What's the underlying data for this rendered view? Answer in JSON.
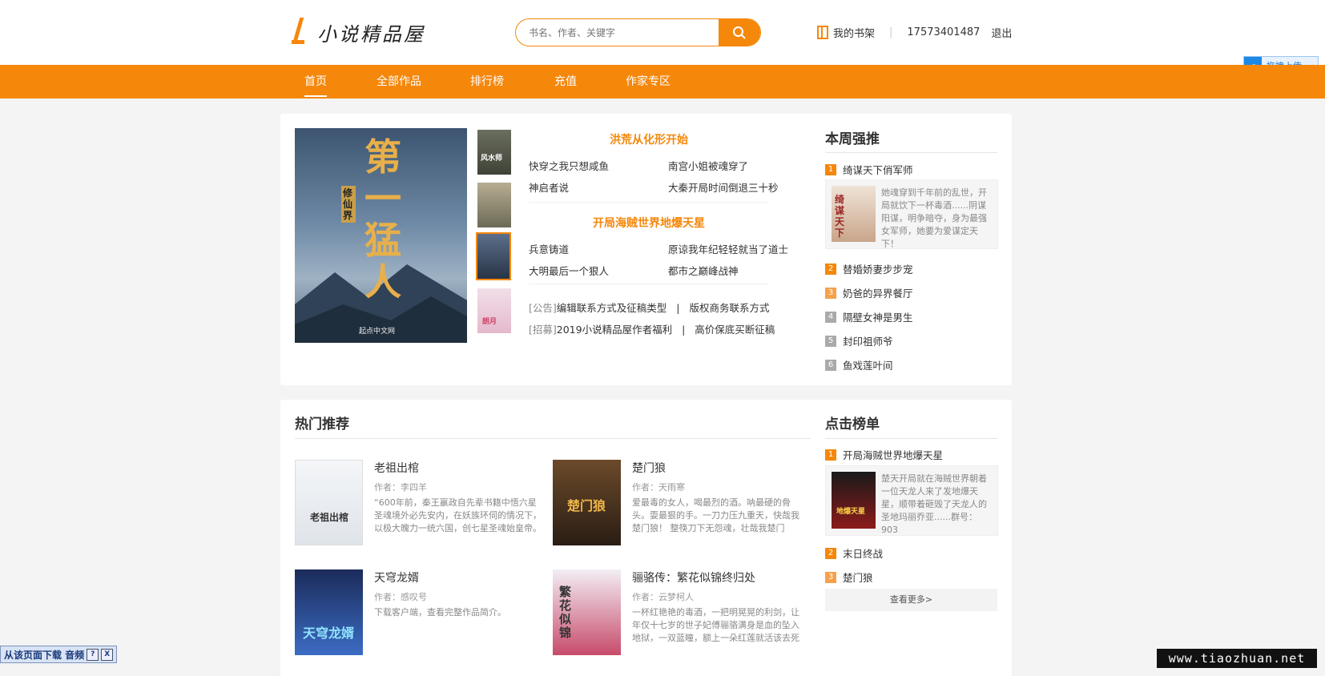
{
  "header": {
    "logo_text": "小说精品屋",
    "search_placeholder": "书名、作者、关键字",
    "shelf_label": "我的书架",
    "separator": "|",
    "phone": "17573401487",
    "logout_label": "退出"
  },
  "nav": {
    "items": [
      "首页",
      "全部作品",
      "排行榜",
      "充值",
      "作家专区"
    ]
  },
  "upload_button": "拖拽上传",
  "featured": {
    "cover_title": "第一猛人",
    "cover_subtitle": "修仙界",
    "cover_publisher": "起点中文网",
    "thumb_labels": [
      "风水师",
      "",
      "",
      "朗月"
    ],
    "groups": [
      {
        "title": "洪荒从化形开始",
        "links": [
          "快穿之我只想咸鱼",
          "南宫小姐被魂穿了",
          "神启者说",
          "大秦开局时间倒退三十秒"
        ]
      },
      {
        "title": "开局海贼世界地爆天星",
        "links": [
          "兵意铸道",
          "原谅我年纪轻轻就当了道士",
          "大明最后一个狠人",
          "都市之巅峰战神"
        ]
      }
    ],
    "notices": [
      {
        "tag": "[公告]",
        "a": "编辑联系方式及征稿类型",
        "sep": "|",
        "b": "版权商务联系方式"
      },
      {
        "tag": "[招募]",
        "a": "2019小说精品屋作者福利",
        "sep": "|",
        "b": "高价保底买断征稿"
      }
    ]
  },
  "weekly": {
    "title": "本周强推",
    "items": [
      "绮谋天下俏军师",
      "替婚娇妻步步宠",
      "奶爸的异界餐厅",
      "隔壁女神是男生",
      "封印祖师爷",
      "鱼戏莲叶间"
    ],
    "nums": [
      "1",
      "2",
      "3",
      "4",
      "5",
      "6"
    ],
    "top_desc": "她魂穿到千年前的乱世，开局就饮下一杯毒酒......阴谋阳谋，明争暗夺，身为最强女军师，她要为爱谋定天下！",
    "top_cover_label": "绮谋天下"
  },
  "hot": {
    "title": "热门推荐",
    "books": [
      {
        "title": "老祖出棺",
        "author": "作者：李四羊",
        "desc": "“600年前，秦王嬴政自先辈书籍中悟六星圣魂境外必先安内，在妖族环伺的情况下，以极大魄力一统六国，创七星圣魂始皇帝。",
        "cover_label": "老祖出棺"
      },
      {
        "title": "楚门狼",
        "author": "作者：天雨寒",
        "desc": "爱最毒的女人，喝最烈的酒。呐最硬的骨头。耍最狠的手。一刀力压九重天，快哉我楚门狼！ 整筷刀下无怨魂，壮哉我楚门",
        "cover_label": "楚门狼"
      },
      {
        "title": "天穹龙婿",
        "author": "作者：感叹号",
        "desc": "下载客户端，查看完整作品简介。",
        "cover_label": "天穹龙婿"
      },
      {
        "title": "骊骆传：繁花似锦终归处",
        "author": "作者：云梦柯人",
        "desc": "一杯红艳艳的毒酒，一把明晃晃的利剑，让年仅十七岁的世子妃傅骊骆满身是血的坠入地狱，一双蓝瞳，额上一朵红莲就活该去死",
        "cover_label": "繁花似锦"
      }
    ]
  },
  "click_rank": {
    "title": "点击榜单",
    "items": [
      "开局海贼世界地爆天星",
      "末日终战",
      "楚门狼"
    ],
    "nums": [
      "1",
      "2",
      "3"
    ],
    "top_desc": "楚天开局就在海贼世界朝着一位天龙人来了发地爆天星，顺带着砸毁了天龙人的圣地玛丽乔亚......群号：903",
    "top_cover_label": "地爆天星",
    "more": "查看更多>"
  },
  "bottom_tool": {
    "label": "从该页面下载 音频",
    "btn_help": "?",
    "btn_close": "X"
  },
  "watermark": "www.tiaozhuan.net",
  "colors": {
    "accent": "#f5870b",
    "rank_top": "#f5870b",
    "rank_mid": "#f6a14b",
    "rank_low": "#aaaaaa"
  }
}
